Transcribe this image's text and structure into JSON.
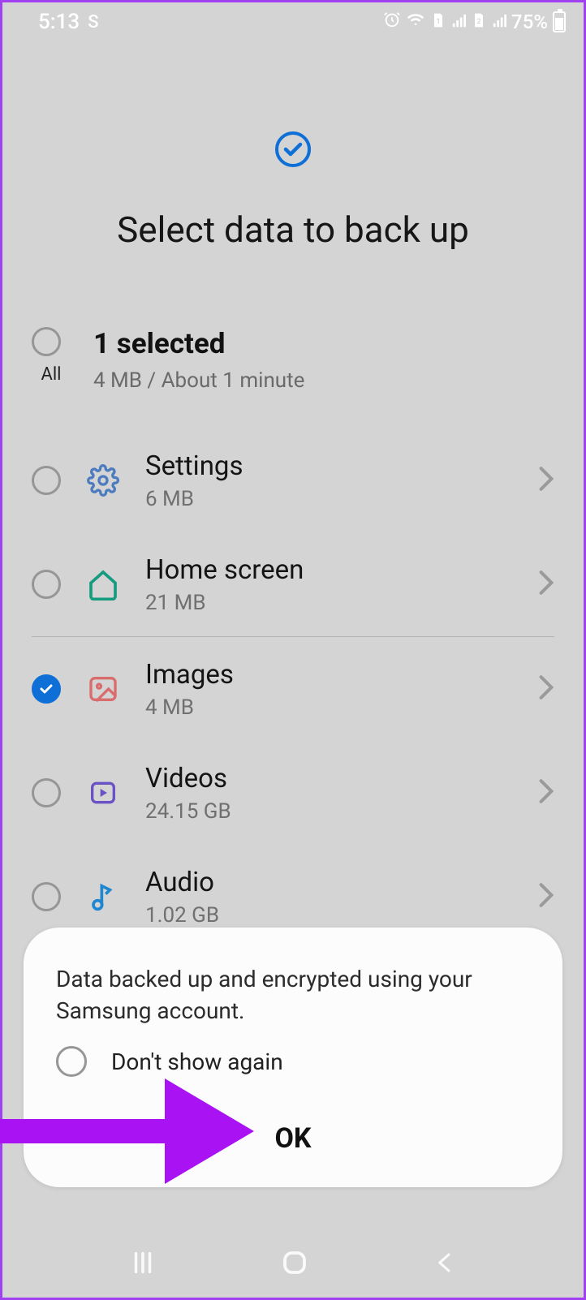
{
  "status": {
    "time": "5:13",
    "app_indicator": "S",
    "battery_percent": "75%"
  },
  "header": {
    "title": "Select data to back up"
  },
  "summary": {
    "all_label": "All",
    "selected_count": "1 selected",
    "estimate": "4 MB / About 1 minute"
  },
  "items": [
    {
      "name": "Settings",
      "size": "6 MB",
      "checked": false,
      "icon": "gear",
      "icon_color": "#4d7bbf"
    },
    {
      "name": "Home screen",
      "size": "21 MB",
      "checked": false,
      "icon": "home",
      "icon_color": "#159b7f"
    },
    {
      "name": "Images",
      "size": "4 MB",
      "checked": true,
      "icon": "image",
      "icon_color": "#d96c6c"
    },
    {
      "name": "Videos",
      "size": "24.15 GB",
      "checked": false,
      "icon": "video",
      "icon_color": "#6a52c4"
    },
    {
      "name": "Audio",
      "size": "1.02 GB",
      "checked": false,
      "icon": "audio",
      "icon_color": "#1f86d1"
    }
  ],
  "toast": {
    "message": "Data backed up and encrypted using your Samsung account.",
    "dont_show": "Don't show again",
    "ok": "OK"
  },
  "colors": {
    "accent": "#0e6fd7",
    "annotation": "#a913f3"
  }
}
